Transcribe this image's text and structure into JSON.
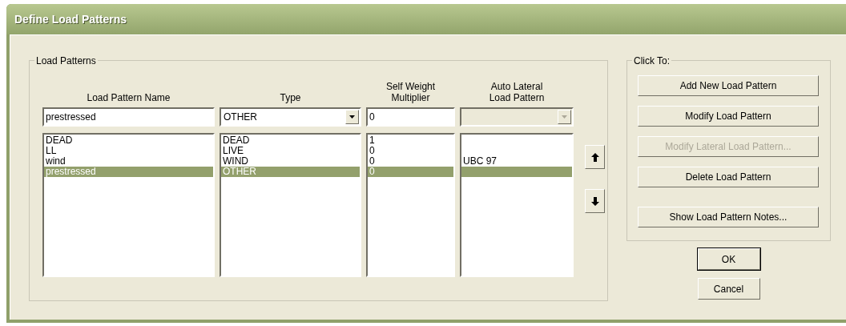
{
  "window": {
    "title": "Define Load Patterns"
  },
  "load_patterns": {
    "title": "Load Patterns",
    "columns": [
      {
        "label": "Load Pattern Name"
      },
      {
        "label": "Type"
      },
      {
        "label": "Self Weight Multiplier"
      },
      {
        "label": "Auto Lateral Load Pattern"
      }
    ],
    "editor": {
      "name": "prestressed",
      "type": "OTHER",
      "multiplier": "0",
      "auto_lateral_disabled": true
    },
    "rows": [
      {
        "name": "DEAD",
        "type": "DEAD",
        "multiplier": "1",
        "selected": false
      },
      {
        "name": "LL",
        "type": "LIVE",
        "multiplier": "0",
        "selected": false
      },
      {
        "name": "wind",
        "type": "WIND",
        "multiplier": "0",
        "auto_lateral": "UBC 97",
        "selected": false
      },
      {
        "name": "prestressed",
        "type": "OTHER",
        "multiplier": "0",
        "selected": true
      }
    ]
  },
  "click_to": {
    "title": "Click To:",
    "buttons": [
      {
        "label": "Add New Load Pattern",
        "disabled": false
      },
      {
        "label": "Modify Load Pattern",
        "disabled": false
      },
      {
        "label": "Modify Lateral Load Pattern...",
        "disabled": true
      },
      {
        "label": "Delete Load Pattern",
        "disabled": false
      },
      {
        "label": "Show Load Pattern Notes...",
        "disabled": false
      }
    ]
  },
  "dialog_buttons": [
    {
      "label": "OK",
      "default": true
    },
    {
      "label": "Cancel",
      "default": false
    }
  ]
}
